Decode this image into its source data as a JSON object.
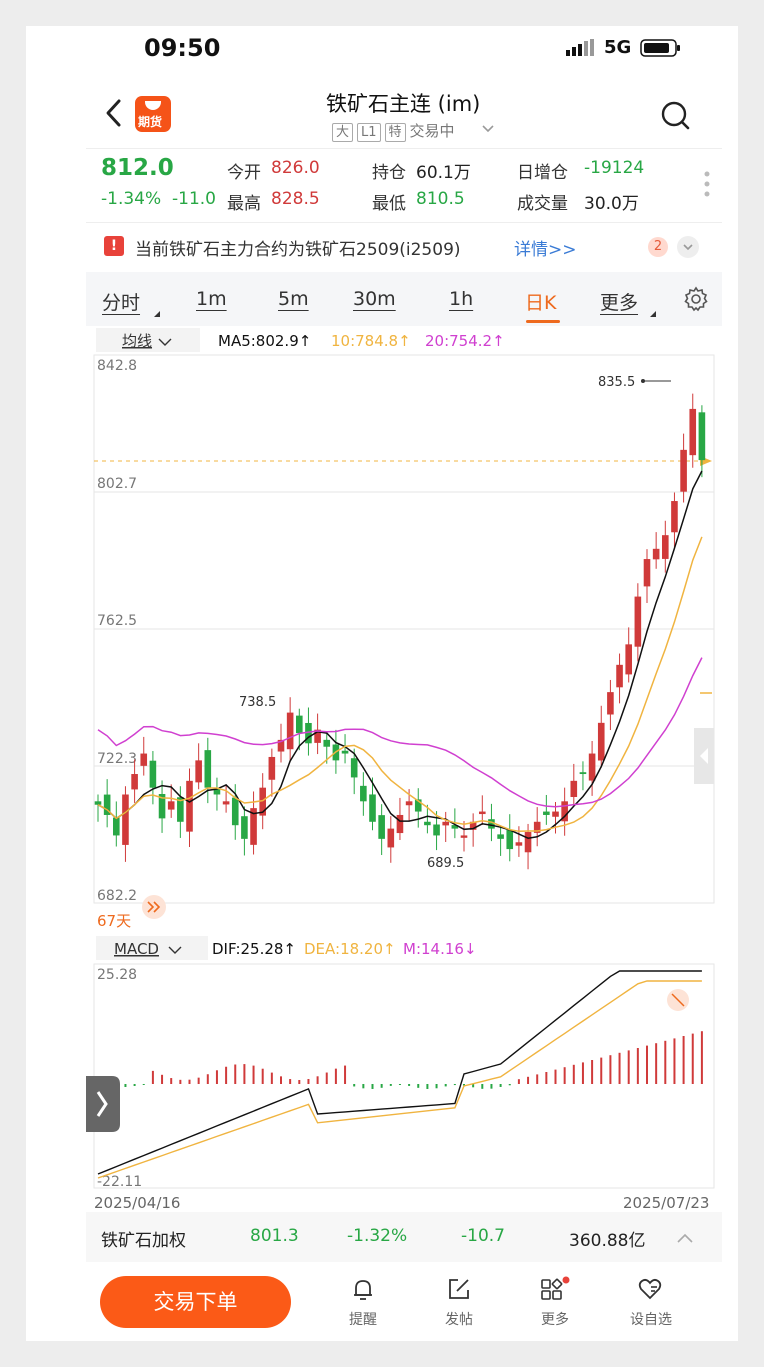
{
  "status_bar": {
    "time": "09:50",
    "network": "5G"
  },
  "header": {
    "app_icon_text": "期货",
    "title": "铁矿石主连 (im)",
    "tags": [
      "大",
      "L1",
      "特"
    ],
    "status": "交易中"
  },
  "quote": {
    "price": "812.0",
    "change_pct": "-1.34%",
    "change": "-11.0",
    "open_label": "今开",
    "open": "826.0",
    "high_label": "最高",
    "high": "828.5",
    "oi_label": "持仓",
    "oi": "60.1万",
    "low_label": "最低",
    "low": "810.5",
    "oi_change_label": "日增仓",
    "oi_change": "-19124",
    "volume_label": "成交量",
    "volume": "30.0万"
  },
  "notice": {
    "text": "当前铁矿石主力合约为铁矿石2509(i2509)",
    "link": "详情>>",
    "badge": "2"
  },
  "period_tabs": [
    "分时",
    "1m",
    "5m",
    "30m",
    "1h",
    "日K",
    "更多"
  ],
  "active_tab": "日K",
  "ma_bar": {
    "selector": "均线",
    "ma5": "MA5:802.9↑",
    "ma10": "10:784.8↑",
    "ma20": "20:754.2↑",
    "ma5_color": "#111111",
    "ma10_color": "#f0b440",
    "ma20_color": "#d040d0"
  },
  "kline": {
    "y_labels": [
      "842.8",
      "802.7",
      "762.5",
      "722.3",
      "682.2"
    ],
    "high_marker": "835.5",
    "low_marker": "689.5",
    "peak_marker": "738.5",
    "days": "67天",
    "up_color": "#d03a3a",
    "down_color": "#28a745"
  },
  "macd_bar": {
    "selector": "MACD",
    "dif": "DIF:25.28↑",
    "dea": "DEA:18.20↑",
    "m": "M:14.16↓"
  },
  "macd": {
    "y_top": "25.28",
    "y_bottom": "-22.11",
    "date_start": "2025/04/16",
    "date_end": "2025/07/23"
  },
  "index_row": {
    "name": "铁矿石加权",
    "price": "801.3",
    "change_pct": "-1.32%",
    "change": "-10.7",
    "amount": "360.88亿"
  },
  "bottom_nav": {
    "trade_button": "交易下单",
    "items": [
      "提醒",
      "发帖",
      "更多",
      "设自选"
    ]
  }
}
